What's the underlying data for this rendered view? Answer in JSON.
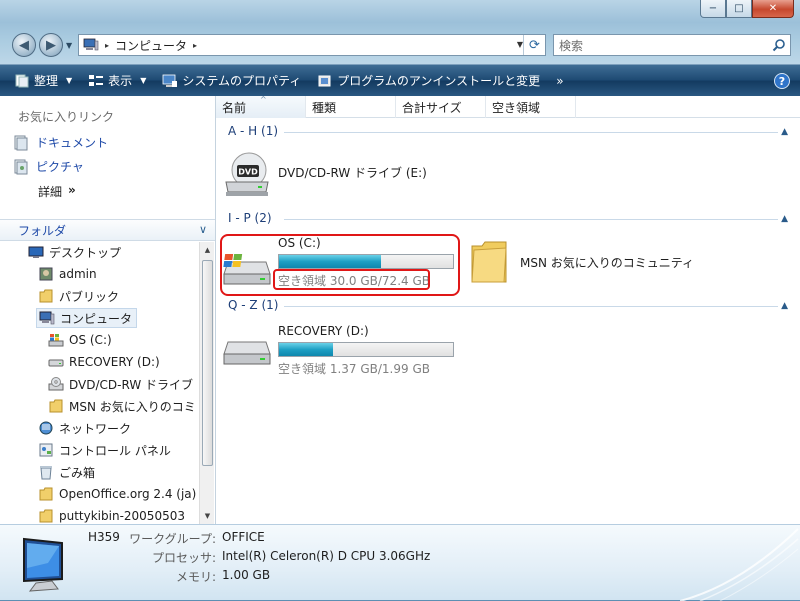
{
  "window": {
    "caption_min": "−",
    "caption_max": "□",
    "caption_close": "✕"
  },
  "address": {
    "path": "コンピュータ",
    "separator": "▸"
  },
  "search": {
    "placeholder": "検索"
  },
  "toolbar": {
    "organize": "整理",
    "views": "表示",
    "system_properties": "システムのプロパティ",
    "uninstall": "プログラムのアンインストールと変更",
    "more": "»",
    "help": "?"
  },
  "favorites": {
    "title": "お気に入りリンク",
    "items": [
      "ドキュメント",
      "ピクチャ"
    ],
    "details_label": "詳細",
    "details_arrow": "»"
  },
  "folders": {
    "title": "フォルダ",
    "tree": [
      {
        "label": "デスクトップ",
        "icon": "desktop-icon"
      },
      {
        "label": "admin",
        "icon": "user-folder-icon"
      },
      {
        "label": "パブリック",
        "icon": "folder-icon"
      },
      {
        "label": "コンピュータ",
        "icon": "computer-icon",
        "selected": true
      },
      {
        "label": "OS (C:)",
        "icon": "windows-drive-icon"
      },
      {
        "label": "RECOVERY (D:)",
        "icon": "drive-icon"
      },
      {
        "label": "DVD/CD-RW ドライブ",
        "icon": "dvd-drive-icon"
      },
      {
        "label": "MSN お気に入りのコミ",
        "icon": "folder-icon"
      },
      {
        "label": "ネットワーク",
        "icon": "network-icon"
      },
      {
        "label": "コントロール パネル",
        "icon": "control-panel-icon"
      },
      {
        "label": "ごみ箱",
        "icon": "recycle-bin-icon"
      },
      {
        "label": "OpenOffice.org 2.4 (ja)",
        "icon": "folder-icon"
      },
      {
        "label": "puttykibin-20050503",
        "icon": "folder-icon"
      }
    ]
  },
  "columns": [
    "名前",
    "種類",
    "合計サイズ",
    "空き領域"
  ],
  "groups": [
    {
      "label": "A - H (1)"
    },
    {
      "label": "I - P (2)"
    },
    {
      "label": "Q - Z (1)"
    }
  ],
  "drives": {
    "dvd": {
      "name": "DVD/CD-RW ドライブ (E:)",
      "icon_label": "DVD"
    },
    "c": {
      "name": "OS (C:)",
      "free_text": "空き領域 30.0 GB/72.4 GB",
      "used_fraction": 0.586
    },
    "msn": {
      "name": "MSN お気に入りのコミュニティ"
    },
    "d": {
      "name": "RECOVERY (D:)",
      "free_text": "空き領域 1.37 GB/1.99 GB",
      "used_fraction": 0.312
    }
  },
  "details": {
    "computer_name": "H359",
    "workgroup_label": "ワークグループ:",
    "workgroup": "OFFICE",
    "processor_label": "プロセッサ:",
    "processor": "Intel(R) Celeron(R) D CPU 3.06GHz",
    "memory_label": "メモリ:",
    "memory": "1.00 GB"
  },
  "colors": {
    "accent": "#1f4aa8",
    "bar_fill": "#1ea0c4",
    "highlight": "#e01717"
  }
}
